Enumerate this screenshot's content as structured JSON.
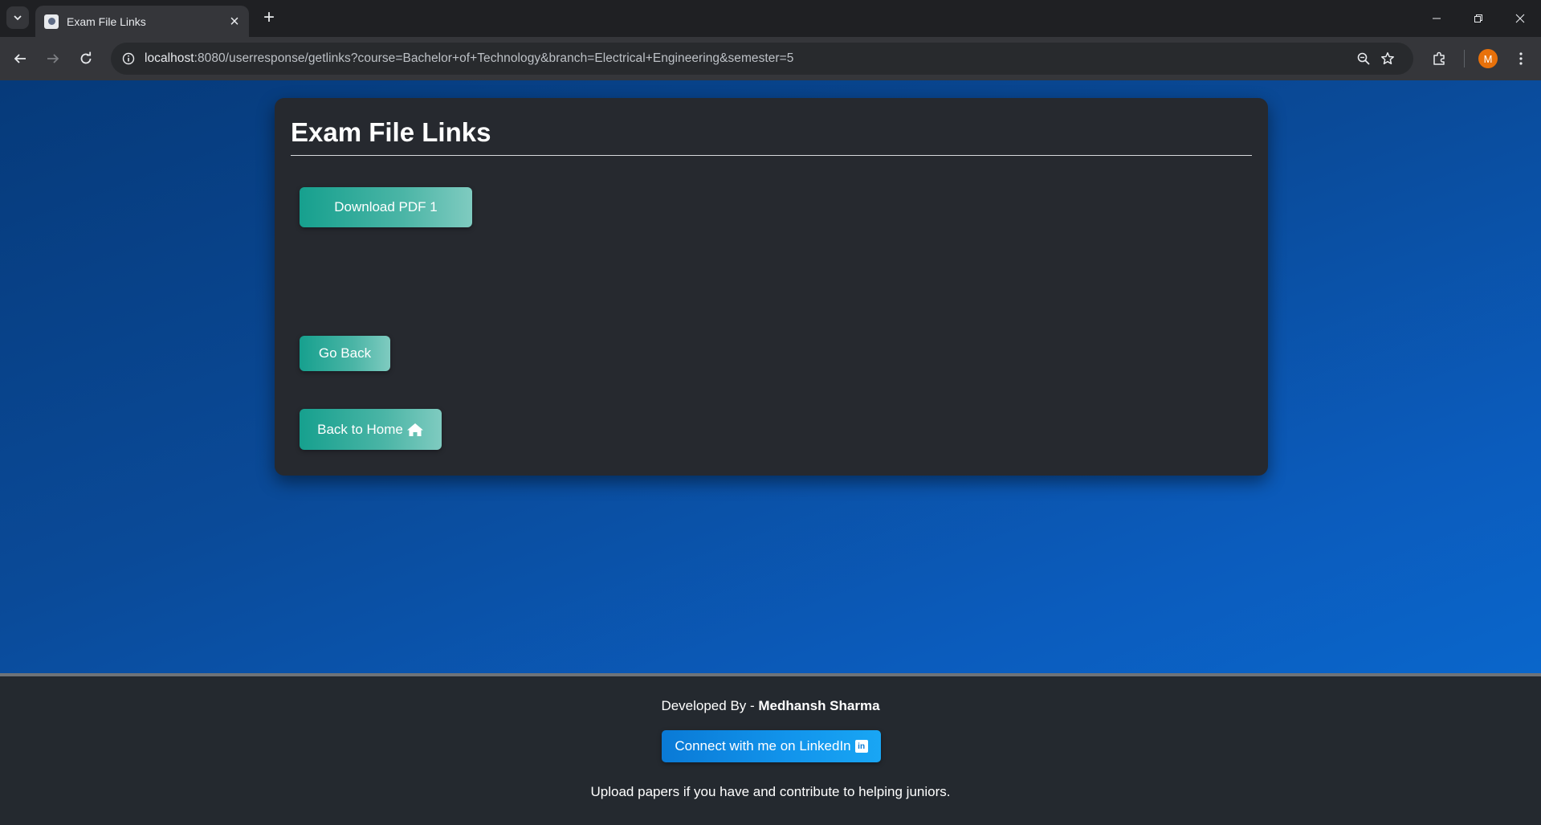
{
  "browser": {
    "tab_title": "Exam File Links",
    "new_tab_symbol": "+",
    "url_host": "localhost",
    "url_rest": ":8080/userresponse/getlinks?course=Bachelor+of+Technology&branch=Electrical+Engineering&semester=5",
    "profile_initial": "M"
  },
  "card": {
    "title": "Exam File Links",
    "download_button": "Download PDF 1",
    "go_back_button": "Go Back",
    "home_button": "Back to Home"
  },
  "footer": {
    "developed_by_prefix": "Developed By - ",
    "developer_name": "Medhansh Sharma",
    "linkedin_button": "Connect with me on LinkedIn",
    "linkedin_icon_text": "in",
    "upload_text": "Upload papers if you have and contribute to helping juniors."
  },
  "colors": {
    "accent_teal": "#16a08e",
    "linkedin_blue": "#0a7ad6",
    "card_bg": "#26292f",
    "page_gradient_start": "#063a7a",
    "page_gradient_end": "#0a66cb"
  },
  "icons": [
    "tab-search-icon",
    "favicon-icon",
    "close-icon",
    "new-tab-icon",
    "minimize-icon",
    "restore-icon",
    "window-close-icon",
    "back-arrow-icon",
    "forward-arrow-icon",
    "reload-icon",
    "site-info-icon",
    "zoom-icon",
    "star-icon",
    "extensions-icon",
    "home-icon",
    "linkedin-icon"
  ]
}
